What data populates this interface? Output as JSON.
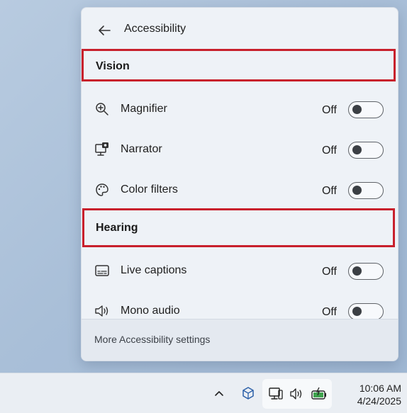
{
  "panel": {
    "title": "Accessibility",
    "footer_link": "More Accessibility settings"
  },
  "sections": {
    "vision": {
      "label": "Vision",
      "items": [
        {
          "label": "Magnifier",
          "state": "Off",
          "icon": "magnifier-icon",
          "on": false
        },
        {
          "label": "Narrator",
          "state": "Off",
          "icon": "narrator-icon",
          "on": false
        },
        {
          "label": "Color filters",
          "state": "Off",
          "icon": "palette-icon",
          "on": false
        }
      ]
    },
    "hearing": {
      "label": "Hearing",
      "items": [
        {
          "label": "Live captions",
          "state": "Off",
          "icon": "captions-icon",
          "on": false
        },
        {
          "label": "Mono audio",
          "state": "Off",
          "icon": "mono-audio-icon",
          "on": false
        }
      ]
    }
  },
  "taskbar": {
    "time": "10:06 AM",
    "date": "4/24/2025"
  },
  "colors": {
    "highlight": "#c8202c",
    "panel_bg": "#eef2f7",
    "taskbar_bg": "#eaeef3"
  }
}
